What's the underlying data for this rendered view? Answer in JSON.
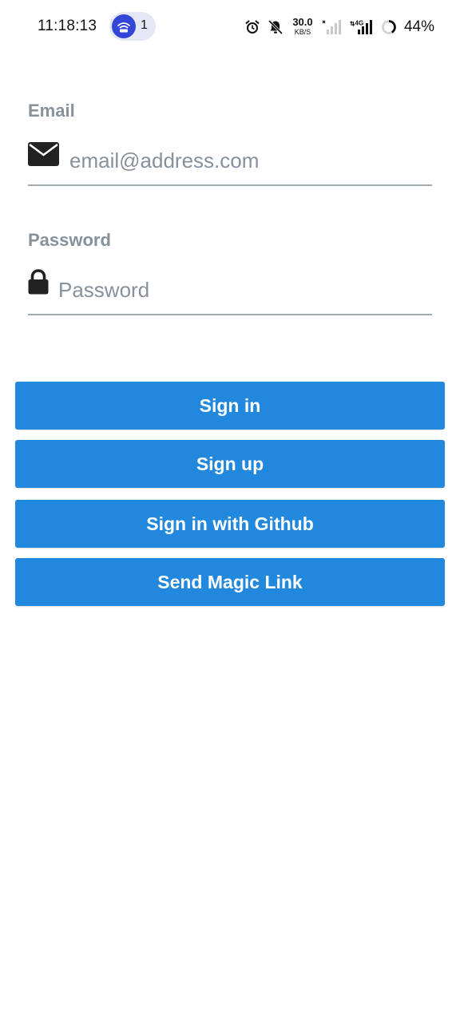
{
  "status_bar": {
    "time": "11:18:13",
    "hotspot_count": "1",
    "net_speed_value": "30.0",
    "net_speed_unit": "KB/S",
    "network_type": "4G",
    "battery_percent": "44%",
    "icons": [
      "hotspot-icon",
      "alarm-icon",
      "bell-off-icon",
      "signal-icon",
      "signal-4g-icon",
      "battery-ring-icon"
    ]
  },
  "form": {
    "email": {
      "label": "Email",
      "placeholder": "email@address.com",
      "value": "",
      "icon": "envelope-icon"
    },
    "password": {
      "label": "Password",
      "placeholder": "Password",
      "value": "",
      "icon": "lock-icon"
    }
  },
  "actions": {
    "sign_in": "Sign in",
    "sign_up": "Sign up",
    "github": "Sign in with Github",
    "magic_link": "Send Magic Link"
  },
  "colors": {
    "primary": "#2288dd",
    "label": "#86919b",
    "underline": "#a3abb2",
    "hotspot": "#3446d8"
  }
}
